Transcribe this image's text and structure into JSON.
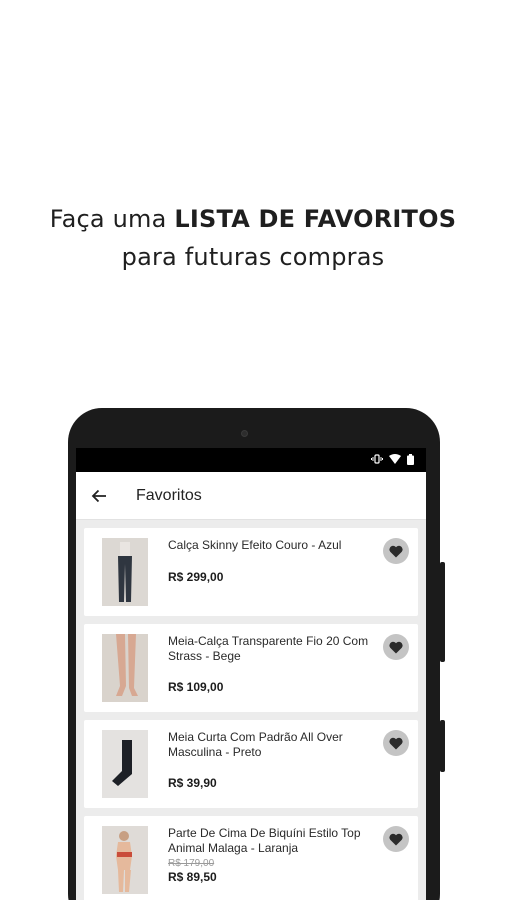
{
  "headline": {
    "line1_prefix": "Faça uma ",
    "line1_bold": "LISTA DE FAVORITOS",
    "line2": "para futuras compras"
  },
  "appbar": {
    "title": "Favoritos",
    "back_icon": "arrow-left-icon"
  },
  "status_icons": [
    "vibrate-icon",
    "wifi-icon",
    "battery-icon"
  ],
  "products": [
    {
      "name": "Calça Skinny Efeito Couro - Azul",
      "price": "R$ 299,00",
      "old_price": ""
    },
    {
      "name": "Meia-Calça Transparente Fio 20 Com Strass - Bege",
      "price": "R$ 109,00",
      "old_price": ""
    },
    {
      "name": "Meia Curta Com Padrão All Over Masculina - Preto",
      "price": "R$ 39,90",
      "old_price": ""
    },
    {
      "name": "Parte De Cima De Biquíni Estilo Top Animal Malaga - Laranja",
      "price": "R$ 89,50",
      "old_price": "R$ 179,00"
    }
  ],
  "colors": {
    "fav_bg": "#c4c4c4",
    "heart": "#2b2b2b",
    "phone": "#1b1b1b",
    "screen_bg": "#ececec"
  }
}
